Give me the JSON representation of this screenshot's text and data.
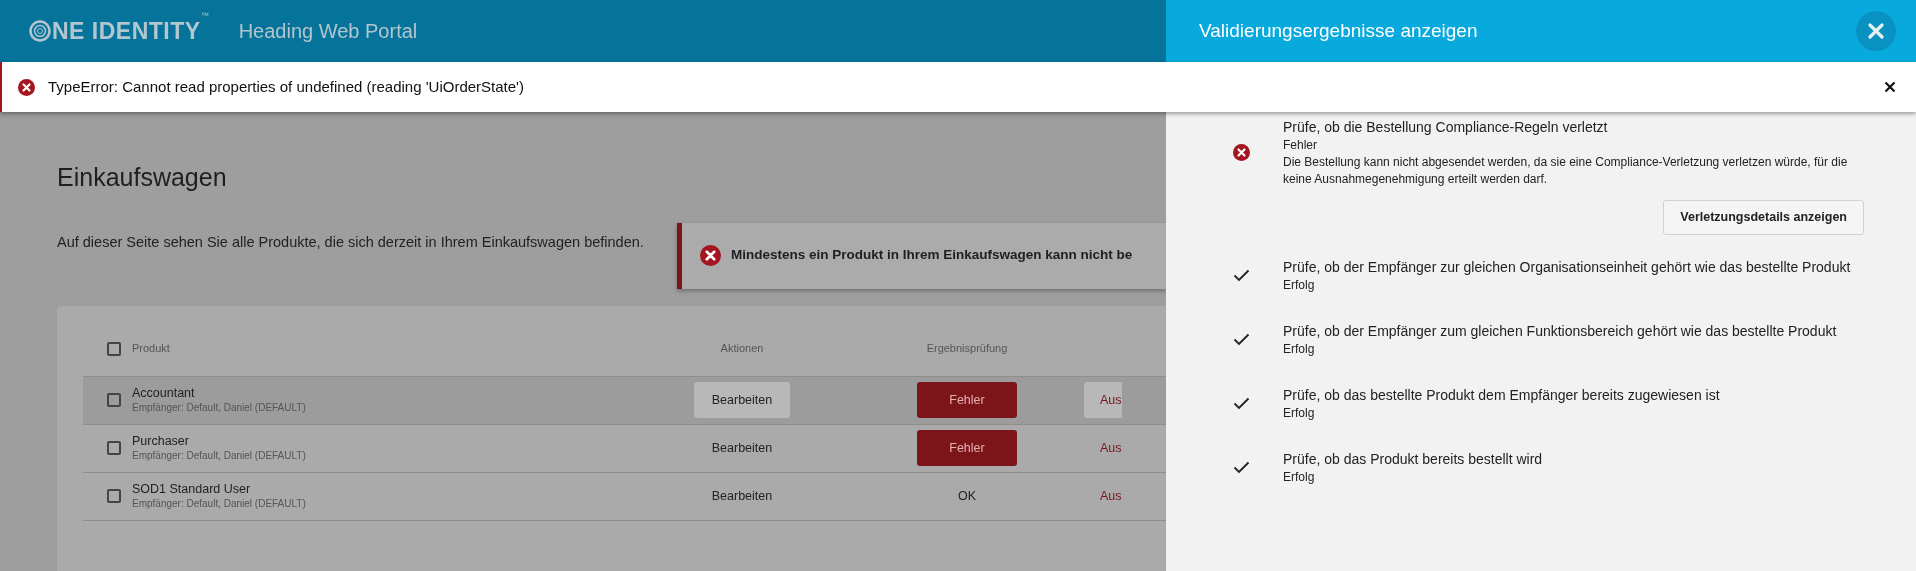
{
  "header": {
    "logo_text": "NE IDENTITY",
    "trademark": "™",
    "title": "Heading Web Portal"
  },
  "error_banner": {
    "message": "TypeError: Cannot read properties of undefined (reading 'UiOrderState')"
  },
  "page": {
    "title": "Einkaufswagen",
    "description": "Auf dieser Seite sehen Sie alle Produkte, die sich derzeit in Ihrem Einkaufswagen befinden.",
    "alert": "Mindestens ein Produkt in Ihrem Einkaufswagen kann nicht be"
  },
  "table": {
    "columns": [
      "Produkt",
      "Aktionen",
      "Ergebnisprüfung"
    ],
    "all_checked": false,
    "rows": [
      {
        "product": "Accountant",
        "recipient": "Empfänger: Default, Daniel (DEFAULT)",
        "checked": false,
        "hovered": true,
        "action": "Bearbeiten",
        "result": "Fehler",
        "kind": "error",
        "column_4": "Aus"
      },
      {
        "product": "Purchaser",
        "recipient": "Empfänger: Default, Daniel (DEFAULT)",
        "checked": false,
        "hovered": false,
        "action": "Bearbeiten",
        "result": "Fehler",
        "kind": "error",
        "column_4": "Aus"
      },
      {
        "product": "SOD1 Standard User",
        "recipient": "Empfänger: Default, Daniel (DEFAULT)",
        "checked": false,
        "hovered": false,
        "action": "Bearbeiten",
        "result": "OK",
        "kind": "ok",
        "column_4": "Aus"
      }
    ]
  },
  "panel": {
    "title": "Validierungsergebnisse anzeigen",
    "checks": [
      {
        "kind": "error",
        "title": "Prüfe, ob die Bestellung Compliance-Regeln verletzt",
        "status": "Fehler",
        "message": "Die Bestellung kann nicht abgesendet werden, da sie eine Compliance-Verletzung verletzen würde, für die keine Ausnahmegenehmigung erteilt werden darf.",
        "button": "Verletzungsdetails anzeigen"
      },
      {
        "kind": "success",
        "title": "Prüfe, ob der Empfänger zur gleichen Organisationseinheit gehört wie das bestellte Produkt",
        "status": "Erfolg"
      },
      {
        "kind": "success",
        "title": "Prüfe, ob der Empfänger zum gleichen Funktionsbereich gehört wie das bestellte Produkt",
        "status": "Erfolg"
      },
      {
        "kind": "success",
        "title": "Prüfe, ob das bestellte Produkt dem Empfänger bereits zugewiesen ist",
        "status": "Erfolg"
      },
      {
        "kind": "success",
        "title": "Prüfe, ob das Produkt bereits bestellt wird",
        "status": "Erfolg"
      }
    ]
  }
}
